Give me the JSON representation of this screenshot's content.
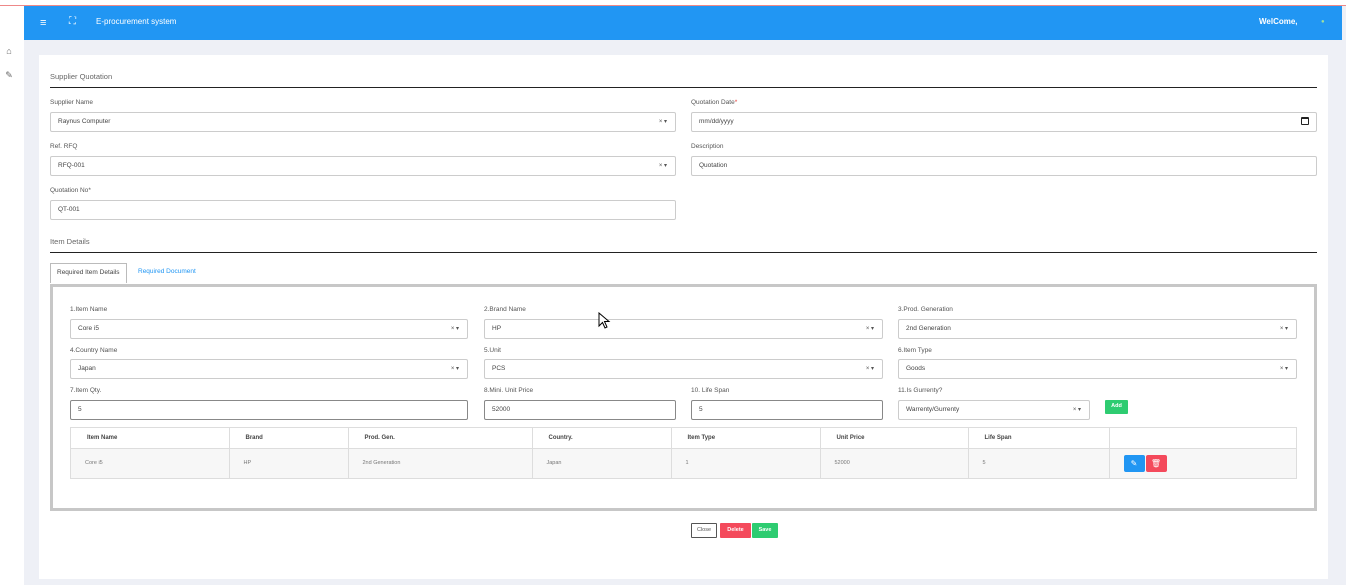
{
  "app": {
    "title": "E-procurement system",
    "welcome": "WelCome,"
  },
  "supplier_section": {
    "heading": "Supplier Quotation",
    "supplier_name": {
      "label": "Supplier Name",
      "value": "Raynus Computer"
    },
    "quotation_date": {
      "label": "Quotation Date",
      "required_mark": "*",
      "placeholder": "mm/dd/yyyy"
    },
    "ref_rfq": {
      "label": "Ref. RFQ",
      "value": "RFQ-001"
    },
    "description": {
      "label": "Description",
      "value": "Quotation"
    },
    "quotation_no": {
      "label": "Quotation No",
      "required_mark": "*",
      "value": "QT-001"
    }
  },
  "item_section": {
    "heading": "Item Details",
    "tabs": [
      "Required Item Details",
      "Required Document"
    ],
    "fields": {
      "item_name": {
        "label": "1.Item Name",
        "value": "Core i5"
      },
      "brand_name": {
        "label": "2.Brand Name",
        "value": "HP"
      },
      "prod_generation": {
        "label": "3.Prod. Generation",
        "value": "2nd Generation"
      },
      "country_name": {
        "label": "4.Country Name",
        "value": "Japan"
      },
      "unit": {
        "label": "5.Unit",
        "value": "PCS"
      },
      "item_type": {
        "label": "6.Item Type",
        "value": "Goods"
      },
      "item_qty": {
        "label": "7.Item Qty.",
        "value": "5"
      },
      "mini_unit_price": {
        "label": "8.Mini. Unit Price",
        "value": "52000"
      },
      "life_span": {
        "label": "10. Life Span",
        "value": "5"
      },
      "is_gurrenty": {
        "label": "11.Is Gurrenty?",
        "value": "Warrenty/Gurrenty"
      }
    },
    "add_label": "Add",
    "table": {
      "headers": [
        "Item Name",
        "Brand",
        "Prod. Gen.",
        "Country.",
        "Item Type",
        "Unit Price",
        "Life Span",
        ""
      ],
      "rows": [
        [
          "Core i5",
          "HP",
          "2nd Generation",
          "Japan",
          "1",
          "52000",
          "5"
        ]
      ]
    }
  },
  "footer_buttons": {
    "close": "Close",
    "delete": "Delete",
    "save": "Save"
  },
  "colors": {
    "primary": "#2196f3",
    "danger": "#f44a5c",
    "success": "#2ecc71"
  }
}
